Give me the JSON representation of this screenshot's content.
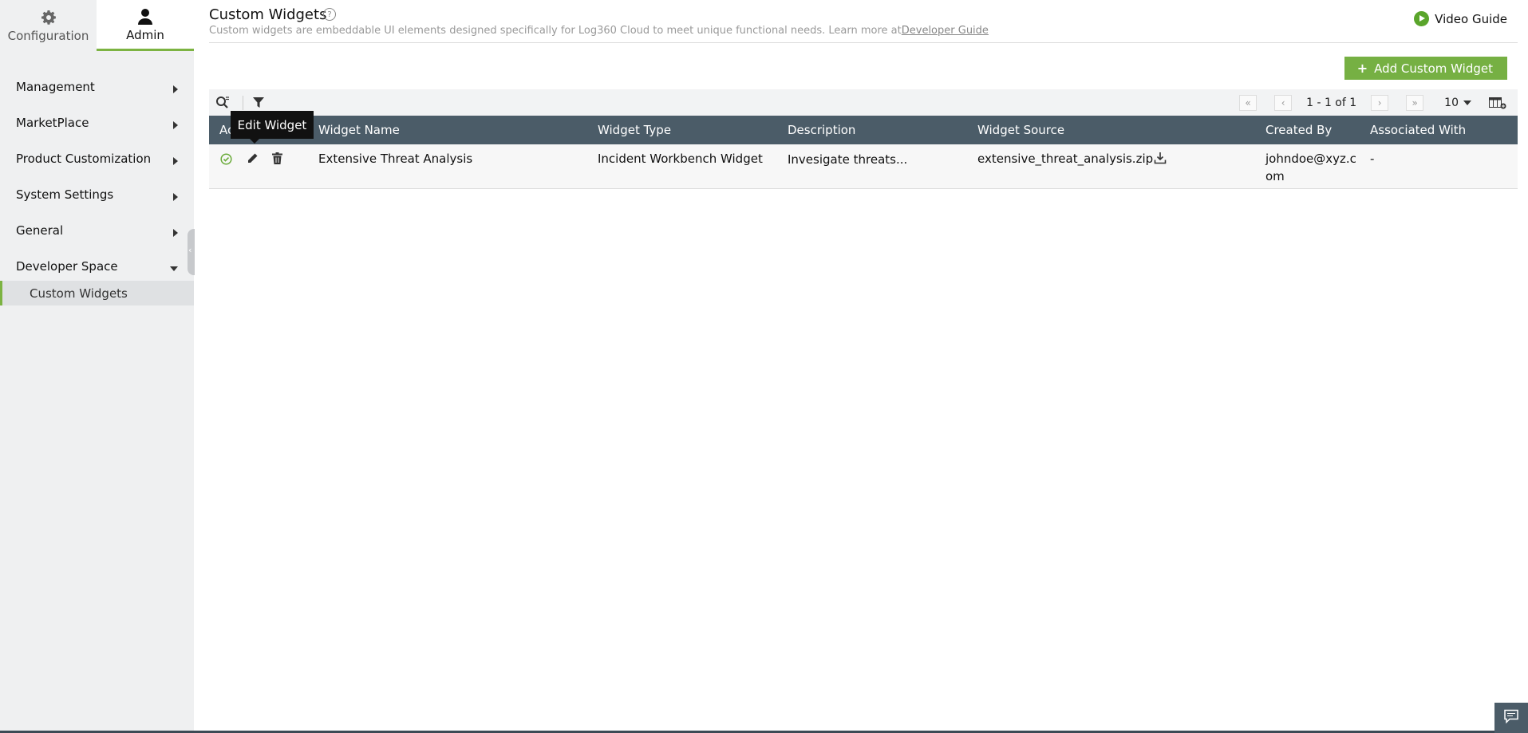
{
  "sidebar": {
    "top_tabs": [
      {
        "label": "Configuration",
        "icon": "gear-icon"
      },
      {
        "label": "Admin",
        "icon": "user-icon"
      }
    ],
    "items": [
      {
        "label": "Management"
      },
      {
        "label": "MarketPlace"
      },
      {
        "label": "Product Customization"
      },
      {
        "label": "System Settings"
      },
      {
        "label": "General"
      },
      {
        "label": "Developer Space"
      }
    ],
    "sub_item": "Custom Widgets"
  },
  "header": {
    "title": "Custom Widgets",
    "subtitle": "Custom widgets are embeddable UI elements designed specifically for Log360 Cloud to meet unique functional needs. Learn more at",
    "link": "Developer Guide",
    "video_guide": "Video Guide"
  },
  "actions": {
    "add_label": "Add Custom Widget"
  },
  "pager": {
    "range": "1 - 1 of 1",
    "page_size": "10"
  },
  "table": {
    "columns": [
      "Ac",
      "Widget Name",
      "Widget Type",
      "Description",
      "Widget Source",
      "Created By",
      "Associated With"
    ],
    "rows": [
      {
        "name": "Extensive Threat Analysis",
        "type": "Incident Workbench Widget",
        "description": "Invesigate threats...",
        "source": "extensive_threat_analysis.zip",
        "created_by_1": "johndoe@xyz.c",
        "created_by_2": "om",
        "associated": "-"
      }
    ]
  },
  "tooltip": "Edit Widget",
  "colors": {
    "accent": "#76b043",
    "table_header": "#4b5c68",
    "sidebar_bg": "#eff0f1"
  }
}
